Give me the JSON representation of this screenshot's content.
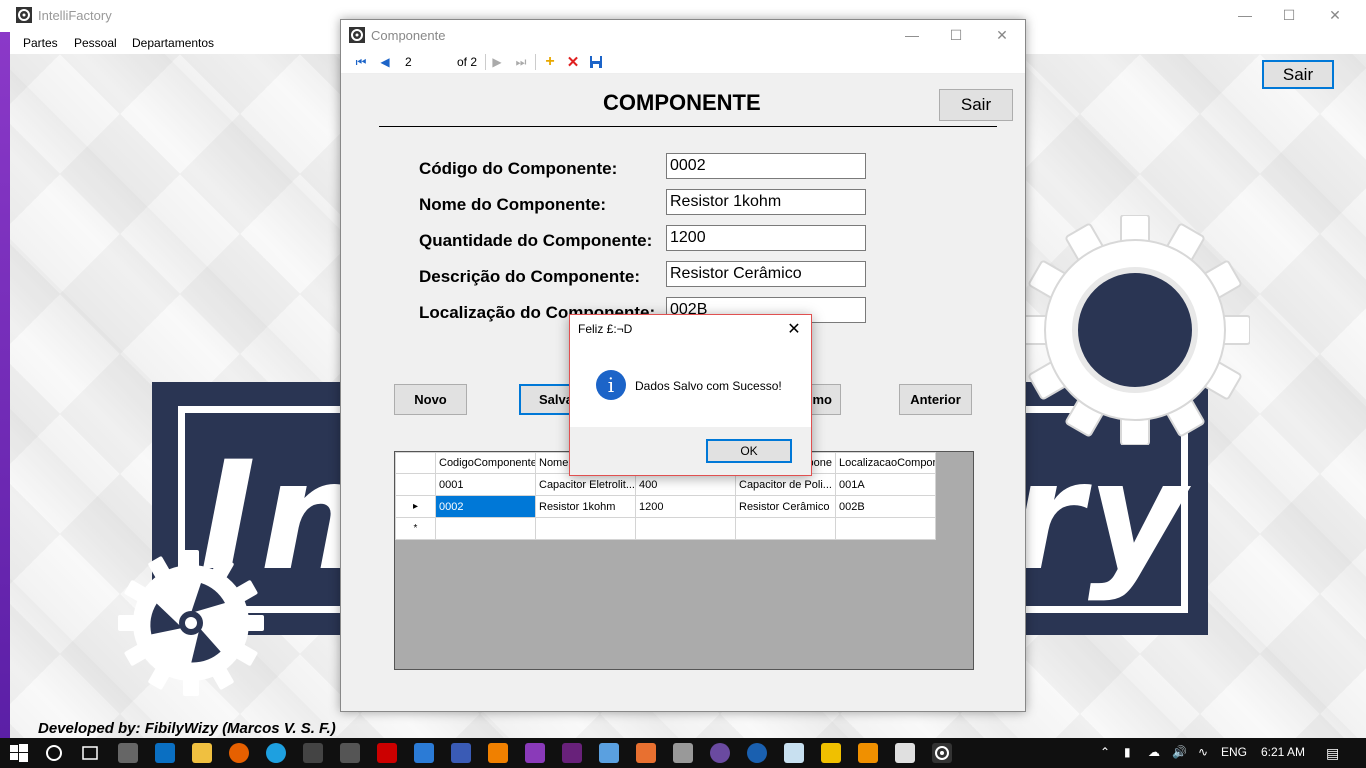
{
  "main_window": {
    "title": "IntelliFactory",
    "menu": [
      "Partes",
      "Pessoal",
      "Departamentos"
    ],
    "sair_label": "Sair",
    "logo_left": "In",
    "logo_right": "ry",
    "credit": "Developed by: FibilyWizy (Marcos V. S. F.)"
  },
  "form_window": {
    "title": "Componente",
    "navigator": {
      "position": "2",
      "of_label": "of 2"
    },
    "heading": "COMPONENTE",
    "sair_label": "Sair",
    "fields": [
      {
        "label": "Código do Componente:",
        "value": "0002"
      },
      {
        "label": "Nome do Componente:",
        "value": "Resistor 1kohm"
      },
      {
        "label": "Quantidade do Componente:",
        "value": "1200"
      },
      {
        "label": "Descrição do Componente:",
        "value": "Resistor Cerâmico"
      },
      {
        "label": "Localização do Componente:",
        "value": "002B"
      }
    ],
    "buttons": {
      "novo": "Novo",
      "salvar": "Salva",
      "proximo": "mo",
      "anterior": "Anterior"
    },
    "grid": {
      "columns": [
        "CodigoComponente",
        "Nome",
        "",
        "ompone",
        "LocalizacaoCompor"
      ],
      "rows": [
        [
          "0001",
          "Capacitor Eletrolit...",
          "400",
          "Capacitor de Poli...",
          "001A"
        ],
        [
          "0002",
          "Resistor 1kohm",
          "1200",
          "Resistor Cerâmico",
          "002B"
        ]
      ],
      "new_row_marker": "*",
      "current_row_marker": "▸"
    }
  },
  "message_box": {
    "title": "Feliz £:¬D",
    "text": "Dados Salvo com Sucesso!",
    "ok_label": "OK",
    "icon": "info-icon"
  },
  "taskbar": {
    "language": "ENG",
    "time": "6:21 AM"
  },
  "colors": {
    "accent": "#0078d7",
    "logo_bg": "#2a3553",
    "taskbar": "#101010"
  }
}
